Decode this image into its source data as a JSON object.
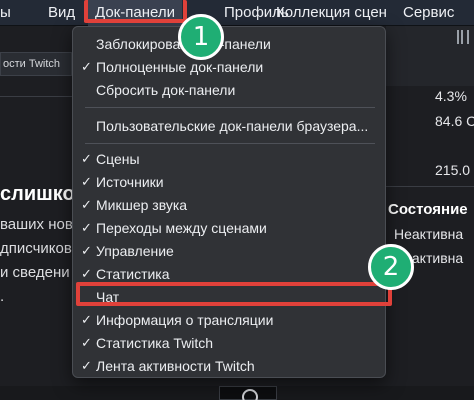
{
  "menubar": {
    "items": [
      {
        "label": "ы"
      },
      {
        "label": "Вид"
      },
      {
        "label": "Док-панели"
      },
      {
        "label": "Профиль"
      },
      {
        "label": "Коллекция сцен"
      },
      {
        "label": "Сервис"
      }
    ]
  },
  "background": {
    "tab_label": "ости Twitch",
    "heading": "слишко",
    "lines": [
      "ваших нов",
      "дписчиков",
      "и сведени",
      "."
    ],
    "stats": [
      "4.3%",
      "84.6 С",
      "215.0"
    ],
    "state_heading": "Состояние",
    "state_values": [
      "Неактивна",
      "Неактивна"
    ]
  },
  "dropdown": {
    "items": [
      {
        "label": "Заблокировать док-панели",
        "checked": ""
      },
      {
        "label": "Полноценные док-панели",
        "checked": "✓"
      },
      {
        "label": "Сбросить док-панели",
        "checked": ""
      },
      {
        "label": "Пользовательские док-панели браузера...",
        "checked": ""
      },
      {
        "label": "Сцены",
        "checked": "✓"
      },
      {
        "label": "Источники",
        "checked": "✓"
      },
      {
        "label": "Микшер звука",
        "checked": "✓"
      },
      {
        "label": "Переходы между сценами",
        "checked": "✓"
      },
      {
        "label": "Управление",
        "checked": "✓"
      },
      {
        "label": "Статистика",
        "checked": "✓"
      },
      {
        "label": "Чат",
        "checked": ""
      },
      {
        "label": "Информация о трансляции",
        "checked": "✓"
      },
      {
        "label": "Статистика Twitch",
        "checked": "✓"
      },
      {
        "label": "Лента активности Twitch",
        "checked": "✓"
      }
    ]
  },
  "annotations": {
    "badge_1": "1",
    "badge_2": "2",
    "highlight_color": "#e0413a",
    "badge_color": "#1fae74"
  }
}
